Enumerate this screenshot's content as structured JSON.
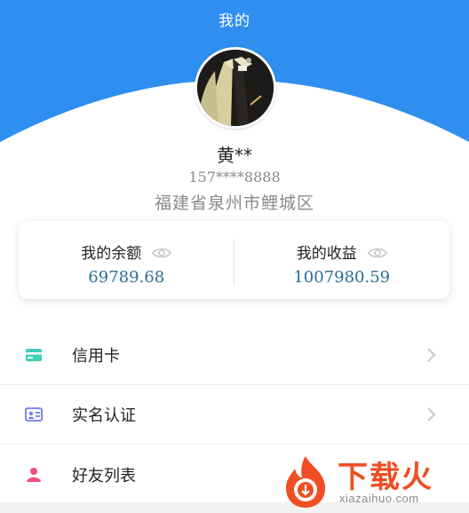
{
  "header": {
    "title": "我的",
    "bg_color": "#2f8ff0"
  },
  "profile": {
    "avatar_icon": "profile-photo",
    "name": "黄**",
    "phone": "157****8888",
    "location": "福建省泉州市鲤城区"
  },
  "stats": {
    "balance": {
      "label": "我的余额",
      "value": "69789.68",
      "icon": "eye-icon"
    },
    "earnings": {
      "label": "我的收益",
      "value": "1007980.59",
      "icon": "eye-icon"
    },
    "value_color": "#2b6f96"
  },
  "menu": {
    "items": [
      {
        "label": "信用卡",
        "icon": "credit-card-icon",
        "icon_color": "#3fd0b4"
      },
      {
        "label": "实名认证",
        "icon": "id-card-icon",
        "icon_color": "#6e7cf0"
      },
      {
        "label": "好友列表",
        "icon": "person-icon",
        "icon_color": "#ef4f7a"
      }
    ]
  },
  "watermark": {
    "text": "下载火",
    "domain": "xiazaihuo.com",
    "color": "#f04e23"
  }
}
